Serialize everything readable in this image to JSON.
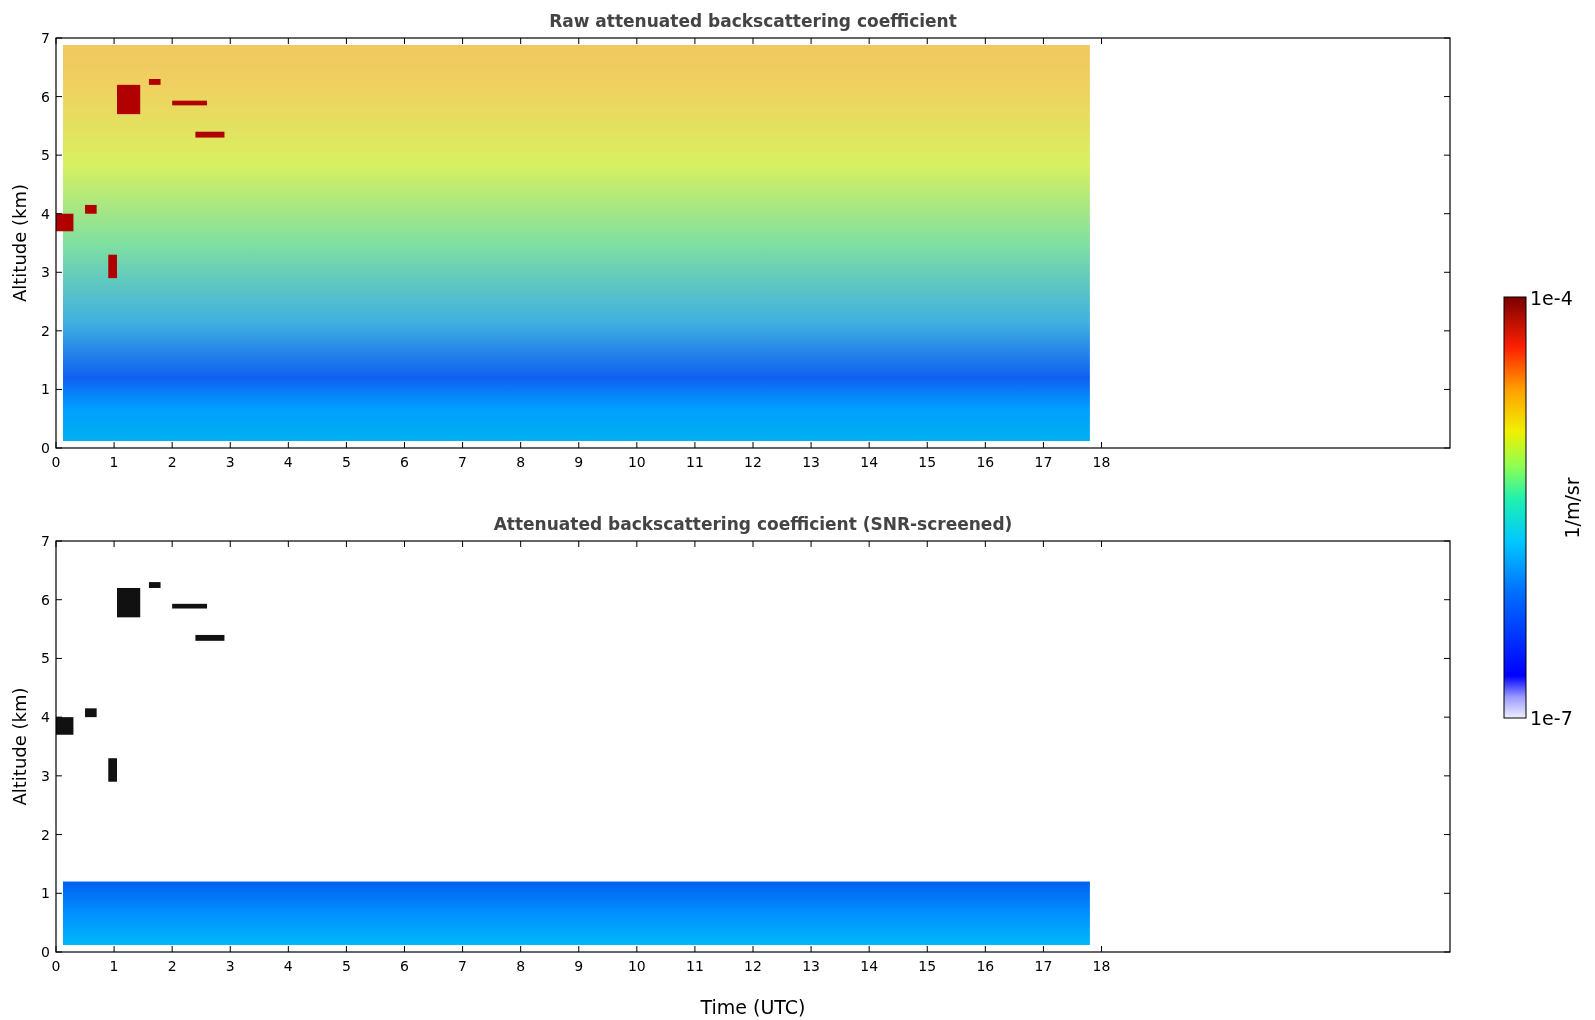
{
  "panels": [
    {
      "kind": "raw",
      "title": "Raw attenuated backscattering coefficient",
      "ylabel": "Altitude (km)",
      "yticks": [
        "7",
        "6",
        "5",
        "4",
        "3",
        "2",
        "1",
        "0"
      ],
      "xticks": [
        "0",
        "1",
        "2",
        "3",
        "4",
        "5",
        "6",
        "7",
        "8",
        "9",
        "10",
        "11",
        "12",
        "13",
        "14",
        "15",
        "16",
        "17",
        "18"
      ]
    },
    {
      "kind": "screened",
      "title": "Attenuated backscattering coefficient (SNR-screened)",
      "ylabel": "Altitude (km)",
      "yticks": [
        "7",
        "6",
        "5",
        "4",
        "3",
        "2",
        "1",
        "0"
      ],
      "xticks": [
        "0",
        "1",
        "2",
        "3",
        "4",
        "5",
        "6",
        "7",
        "8",
        "9",
        "10",
        "11",
        "12",
        "13",
        "14",
        "15",
        "16",
        "17",
        "18"
      ],
      "xlabel": "Time (UTC)"
    }
  ],
  "colorbar": {
    "max_label": "1e-4",
    "min_label": "1e-7",
    "label": "1/m/sr"
  }
}
